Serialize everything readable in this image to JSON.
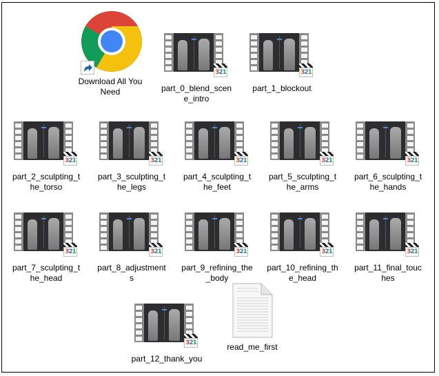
{
  "window": {
    "type": "file-explorer-large-icons"
  },
  "items": [
    {
      "name": "Download All You Need",
      "type": "shortcut",
      "icon": "chrome-icon"
    },
    {
      "name": "part_0_blend_scene_intro",
      "type": "video",
      "icon": "video-file-icon"
    },
    {
      "name": "part_1_blockout",
      "type": "video",
      "icon": "video-file-icon"
    },
    {
      "name": "part_2_sculpting_the_torso",
      "type": "video",
      "icon": "video-file-icon"
    },
    {
      "name": "part_3_sculpting_the_legs",
      "type": "video",
      "icon": "video-file-icon"
    },
    {
      "name": "part_4_sculpting_the_feet",
      "type": "video",
      "icon": "video-file-icon"
    },
    {
      "name": "part_5_sculpting_the_arms",
      "type": "video",
      "icon": "video-file-icon"
    },
    {
      "name": "part_6_sculpting_the_hands",
      "type": "video",
      "icon": "video-file-icon"
    },
    {
      "name": "part_7_sculpting_the_head",
      "type": "video",
      "icon": "video-file-icon"
    },
    {
      "name": "part_8_adjustments",
      "type": "video",
      "icon": "video-file-icon"
    },
    {
      "name": "part_9_refining_the_body",
      "type": "video",
      "icon": "video-file-icon"
    },
    {
      "name": "part_10_refining_the_head",
      "type": "video",
      "icon": "video-file-icon"
    },
    {
      "name": "part_11_final_touches",
      "type": "video",
      "icon": "video-file-icon"
    },
    {
      "name": "part_12_thank_you",
      "type": "video",
      "icon": "video-file-icon"
    },
    {
      "name": "read_me_first",
      "type": "text",
      "icon": "text-document-icon"
    }
  ],
  "badge": {
    "text3": "3",
    "text2": "2",
    "text1": "1"
  },
  "colors": {
    "chrome_red": "#db4437",
    "chrome_yellow": "#f4c20d",
    "chrome_green": "#0f9d58",
    "chrome_blue": "#4285f4"
  }
}
